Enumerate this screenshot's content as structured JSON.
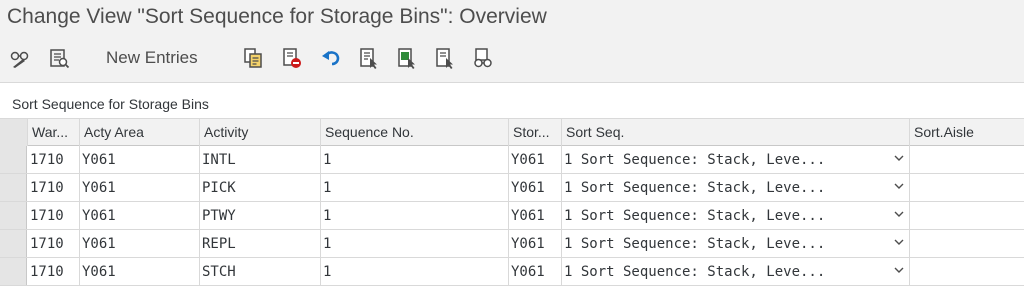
{
  "window": {
    "title": "Change View \"Sort Sequence for Storage Bins\": Overview"
  },
  "toolbar": {
    "new_entries_label": "New Entries",
    "icons": [
      "display-change-icon",
      "details-icon",
      "copy-icon",
      "delete-icon",
      "undo-icon",
      "select-all-icon",
      "select-block-icon",
      "deselect-all-icon",
      "glasses-icon"
    ]
  },
  "section": {
    "title": "Sort Sequence for Storage Bins"
  },
  "table": {
    "columns": [
      "War...",
      "Acty Area",
      "Activity",
      "Sequence No.",
      "Stor...",
      "Sort Seq.",
      "Sort.Aisle"
    ],
    "rows": [
      {
        "warehouse": "1710",
        "acty_area": "Y061",
        "activity": "INTL",
        "seq_no": "1",
        "stor": "Y061",
        "sort_seq": "1 Sort Sequence: Stack, Leve...",
        "sort_aisle": ""
      },
      {
        "warehouse": "1710",
        "acty_area": "Y061",
        "activity": "PICK",
        "seq_no": "1",
        "stor": "Y061",
        "sort_seq": "1 Sort Sequence: Stack, Leve...",
        "sort_aisle": ""
      },
      {
        "warehouse": "1710",
        "acty_area": "Y061",
        "activity": "PTWY",
        "seq_no": "1",
        "stor": "Y061",
        "sort_seq": "1 Sort Sequence: Stack, Leve...",
        "sort_aisle": ""
      },
      {
        "warehouse": "1710",
        "acty_area": "Y061",
        "activity": "REPL",
        "seq_no": "1",
        "stor": "Y061",
        "sort_seq": "1 Sort Sequence: Stack, Leve...",
        "sort_aisle": ""
      },
      {
        "warehouse": "1710",
        "acty_area": "Y061",
        "activity": "STCH",
        "seq_no": "1",
        "stor": "Y061",
        "sort_seq": "1 Sort Sequence: Stack, Leve...",
        "sort_aisle": ""
      }
    ]
  },
  "colors": {
    "accent_blue": "#1a73c7",
    "icon_green": "#2f8a3a",
    "icon_red": "#cc1919",
    "header_bg": "#f2f2f2"
  }
}
